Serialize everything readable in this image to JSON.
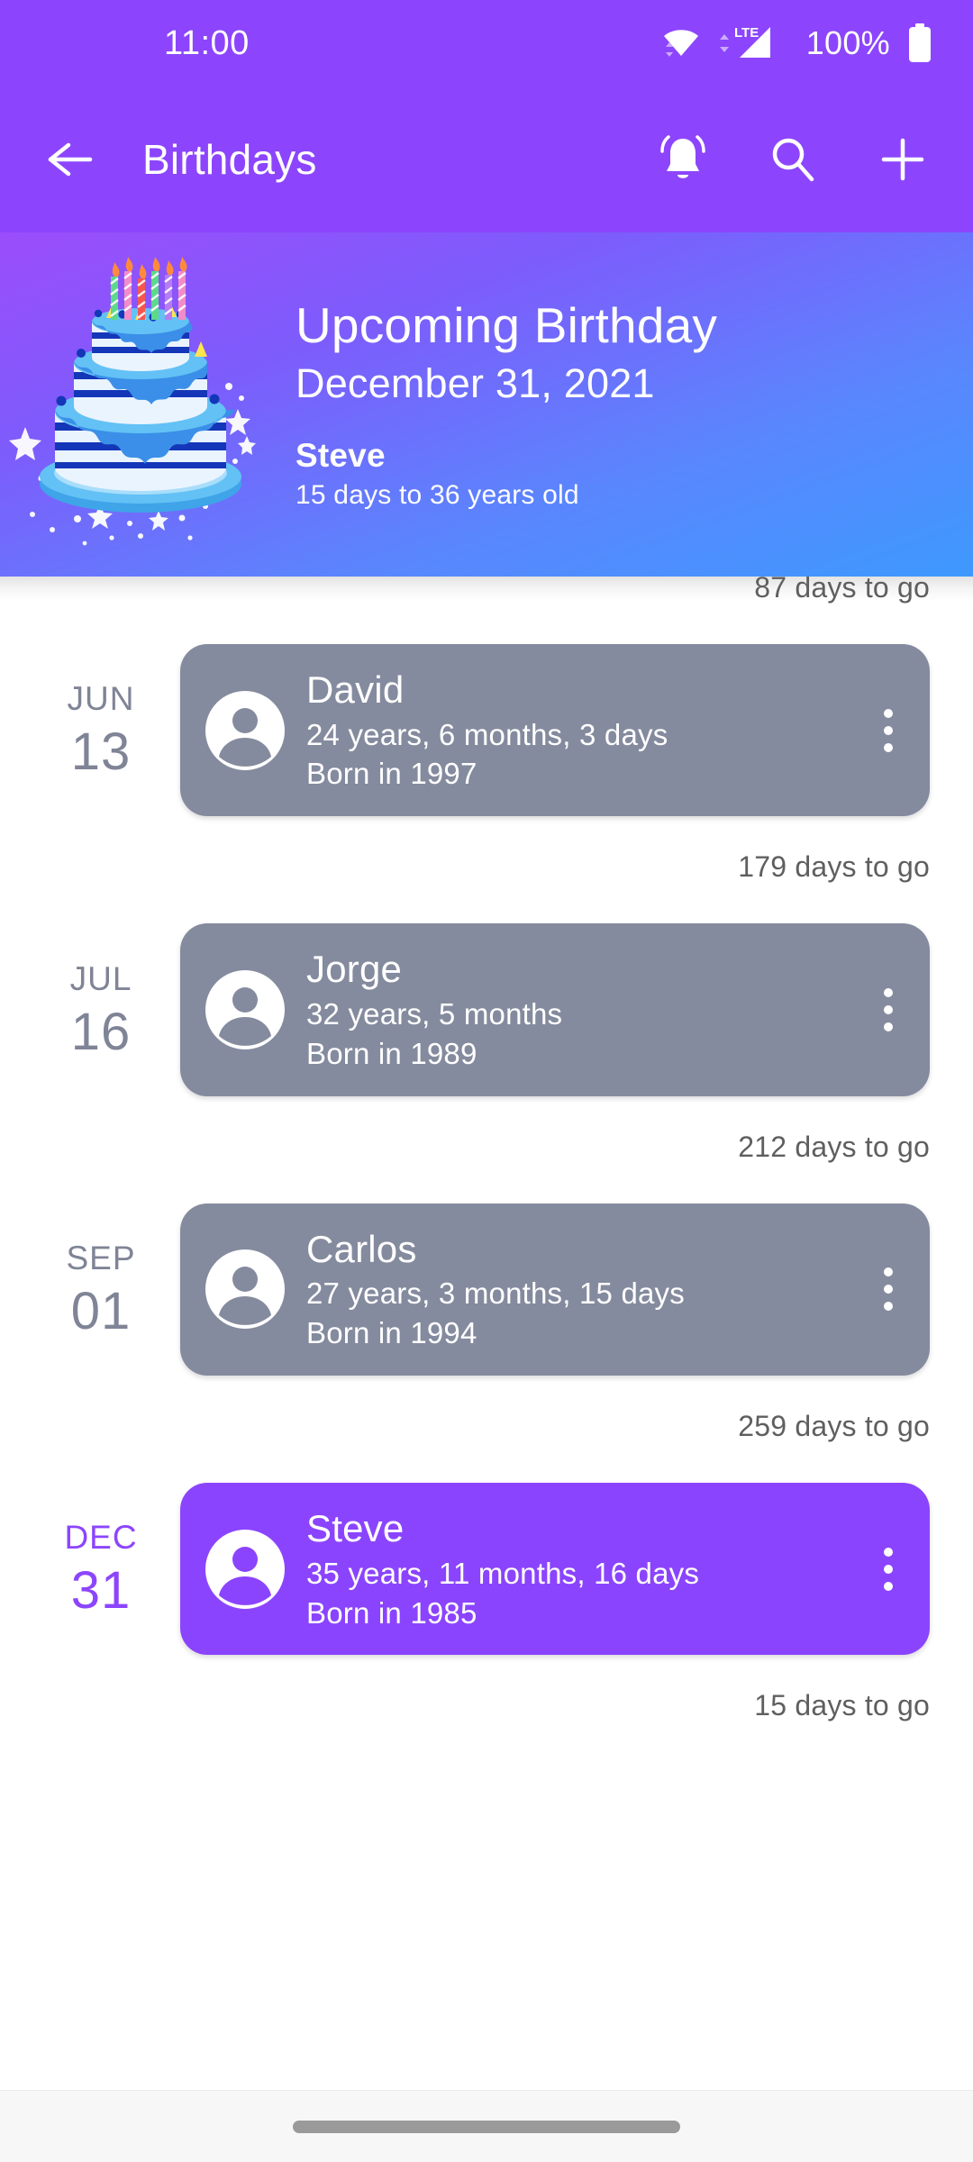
{
  "status_bar": {
    "clock": "11:00",
    "battery_percent": "100%",
    "icons": [
      "wifi-icon",
      "lte-signal-icon",
      "battery-icon"
    ]
  },
  "app_bar": {
    "title": "Birthdays",
    "back_icon": "back-arrow-icon",
    "actions": [
      {
        "icon": "notification-bell-icon",
        "label": "Notifications"
      },
      {
        "icon": "search-icon",
        "label": "Search"
      },
      {
        "icon": "plus-icon",
        "label": "Add birthday"
      }
    ]
  },
  "hero": {
    "title": "Upcoming Birthday",
    "date": "December 31, 2021",
    "name": "Steve",
    "subtitle": "15 days to 36 years old",
    "art": "birthday-cake-illustration",
    "gradient_start": "#9B4DFB",
    "gradient_end": "#3E99FE"
  },
  "colors": {
    "accent_purple": "#8C45FD",
    "card_grey": "#858B9E",
    "date_grey": "#7F8496",
    "days_text": "#5f5f5f"
  },
  "list": {
    "days_label_suffix": "days to go",
    "items": [
      {
        "days_to_go": "87 days to go",
        "month": "JUN",
        "day": "13",
        "name": "David",
        "age": "24 years, 6 months, 3 days",
        "born": "Born in 1997",
        "highlighted": false
      },
      {
        "days_to_go": "179 days to go",
        "month": "JUL",
        "day": "16",
        "name": "Jorge",
        "age": "32 years, 5 months",
        "born": "Born in 1989",
        "highlighted": false
      },
      {
        "days_to_go": "212 days to go",
        "month": "SEP",
        "day": "01",
        "name": "Carlos",
        "age": "27 years, 3 months, 15 days",
        "born": "Born in 1994",
        "highlighted": false
      },
      {
        "days_to_go": "259 days to go",
        "month": "DEC",
        "day": "31",
        "name": "Steve",
        "age": "35 years, 11 months, 16 days",
        "born": "Born in 1985",
        "highlighted": true
      }
    ],
    "footer_days": "15 days to go"
  },
  "nav_bar": {
    "gesture_pill": "home-gesture-pill"
  }
}
